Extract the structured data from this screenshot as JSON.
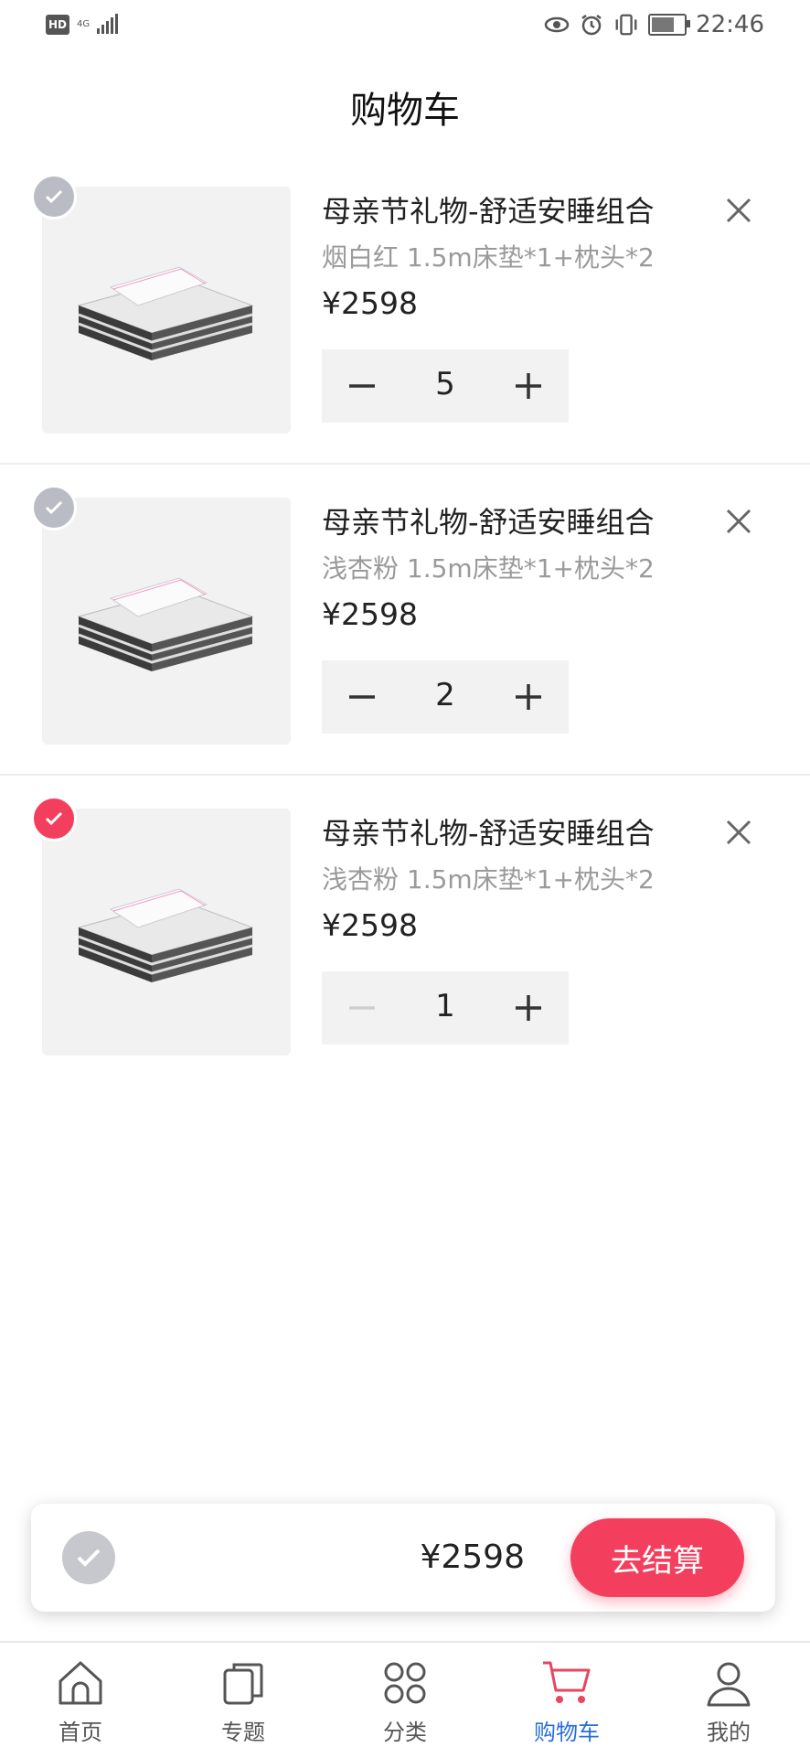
{
  "status_bar": {
    "left": {
      "hd": "HD",
      "network": "4G"
    },
    "time": "22:46"
  },
  "header": {
    "title": "购物车"
  },
  "items": [
    {
      "name": "母亲节礼物-舒适安睡组合",
      "spec": "烟白红 1.5m床垫*1+枕头*2",
      "price": "¥2598",
      "qty": "5",
      "selected": false
    },
    {
      "name": "母亲节礼物-舒适安睡组合",
      "spec": "浅杏粉 1.5m床垫*1+枕头*2",
      "price": "¥2598",
      "qty": "2",
      "selected": false
    },
    {
      "name": "母亲节礼物-舒适安睡组合",
      "spec": "浅杏粉 1.5m床垫*1+枕头*2",
      "price": "¥2598",
      "qty": "1",
      "selected": true
    }
  ],
  "checkout": {
    "total": "¥2598",
    "button": "去结算"
  },
  "tabs": [
    {
      "label": "首页",
      "icon": "home-icon"
    },
    {
      "label": "专题",
      "icon": "topics-icon"
    },
    {
      "label": "分类",
      "icon": "category-icon"
    },
    {
      "label": "购物车",
      "icon": "cart-icon",
      "active": true
    },
    {
      "label": "我的",
      "icon": "profile-icon"
    }
  ],
  "colors": {
    "accent": "#f33f5d",
    "active_tab": "#2a6fd6",
    "unchecked": "#b9bcc4"
  }
}
